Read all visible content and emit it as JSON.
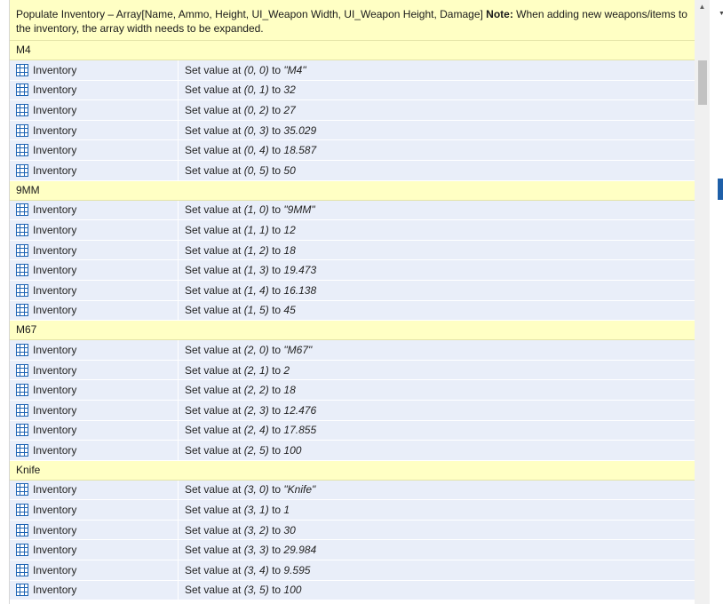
{
  "comment": {
    "text": "Populate Inventory –  Array[Name, Ammo, Height, UI_Weapon Width, UI_Weapon Height, Damage] ",
    "note_label": "Note:",
    "note_text": " When adding new weapons/items to the inventory, the array width needs to be expanded."
  },
  "groups": [
    {
      "name": "M4",
      "rows": [
        {
          "object": "Inventory",
          "prefix": "Set value at ",
          "index": "(0, 0)",
          "to": " to ",
          "value": "\"M4\""
        },
        {
          "object": "Inventory",
          "prefix": "Set value at ",
          "index": "(0, 1)",
          "to": " to ",
          "value": "32"
        },
        {
          "object": "Inventory",
          "prefix": "Set value at ",
          "index": "(0, 2)",
          "to": " to ",
          "value": "27"
        },
        {
          "object": "Inventory",
          "prefix": "Set value at ",
          "index": "(0, 3)",
          "to": " to ",
          "value": "35.029"
        },
        {
          "object": "Inventory",
          "prefix": "Set value at ",
          "index": "(0, 4)",
          "to": " to ",
          "value": "18.587"
        },
        {
          "object": "Inventory",
          "prefix": "Set value at ",
          "index": "(0, 5)",
          "to": " to ",
          "value": "50"
        }
      ]
    },
    {
      "name": "9MM",
      "rows": [
        {
          "object": "Inventory",
          "prefix": "Set value at ",
          "index": "(1, 0)",
          "to": " to ",
          "value": "\"9MM\""
        },
        {
          "object": "Inventory",
          "prefix": "Set value at ",
          "index": "(1, 1)",
          "to": " to ",
          "value": "12"
        },
        {
          "object": "Inventory",
          "prefix": "Set value at ",
          "index": "(1, 2)",
          "to": " to ",
          "value": "18"
        },
        {
          "object": "Inventory",
          "prefix": "Set value at ",
          "index": "(1, 3)",
          "to": " to ",
          "value": "19.473"
        },
        {
          "object": "Inventory",
          "prefix": "Set value at ",
          "index": "(1, 4)",
          "to": " to ",
          "value": "16.138"
        },
        {
          "object": "Inventory",
          "prefix": "Set value at ",
          "index": "(1, 5)",
          "to": " to ",
          "value": "45"
        }
      ]
    },
    {
      "name": "M67",
      "rows": [
        {
          "object": "Inventory",
          "prefix": "Set value at ",
          "index": "(2, 0)",
          "to": " to ",
          "value": "\"M67\""
        },
        {
          "object": "Inventory",
          "prefix": "Set value at ",
          "index": "(2, 1)",
          "to": " to ",
          "value": "2"
        },
        {
          "object": "Inventory",
          "prefix": "Set value at ",
          "index": "(2, 2)",
          "to": " to ",
          "value": "18"
        },
        {
          "object": "Inventory",
          "prefix": "Set value at ",
          "index": "(2, 3)",
          "to": " to ",
          "value": "12.476"
        },
        {
          "object": "Inventory",
          "prefix": "Set value at ",
          "index": "(2, 4)",
          "to": " to ",
          "value": "17.855"
        },
        {
          "object": "Inventory",
          "prefix": "Set value at ",
          "index": "(2, 5)",
          "to": " to ",
          "value": "100"
        }
      ]
    },
    {
      "name": "Knife",
      "rows": [
        {
          "object": "Inventory",
          "prefix": "Set value at ",
          "index": "(3, 0)",
          "to": " to ",
          "value": "\"Knife\""
        },
        {
          "object": "Inventory",
          "prefix": "Set value at ",
          "index": "(3, 1)",
          "to": " to ",
          "value": "1"
        },
        {
          "object": "Inventory",
          "prefix": "Set value at ",
          "index": "(3, 2)",
          "to": " to ",
          "value": "30"
        },
        {
          "object": "Inventory",
          "prefix": "Set value at ",
          "index": "(3, 3)",
          "to": " to ",
          "value": "29.984"
        },
        {
          "object": "Inventory",
          "prefix": "Set value at ",
          "index": "(3, 4)",
          "to": " to ",
          "value": "9.595"
        },
        {
          "object": "Inventory",
          "prefix": "Set value at ",
          "index": "(3, 5)",
          "to": " to ",
          "value": "100"
        }
      ]
    }
  ],
  "icons": {
    "array_object": "array-grid-icon",
    "scroll_up": "scroll-up-arrow-icon",
    "pane_collapse": "chevron-down-icon"
  },
  "colors": {
    "comment_bg": "#ffffc4",
    "row_bg": "#e9eef9",
    "icon_blue": "#1e64b4",
    "accent_tab": "#1e5fa8"
  }
}
